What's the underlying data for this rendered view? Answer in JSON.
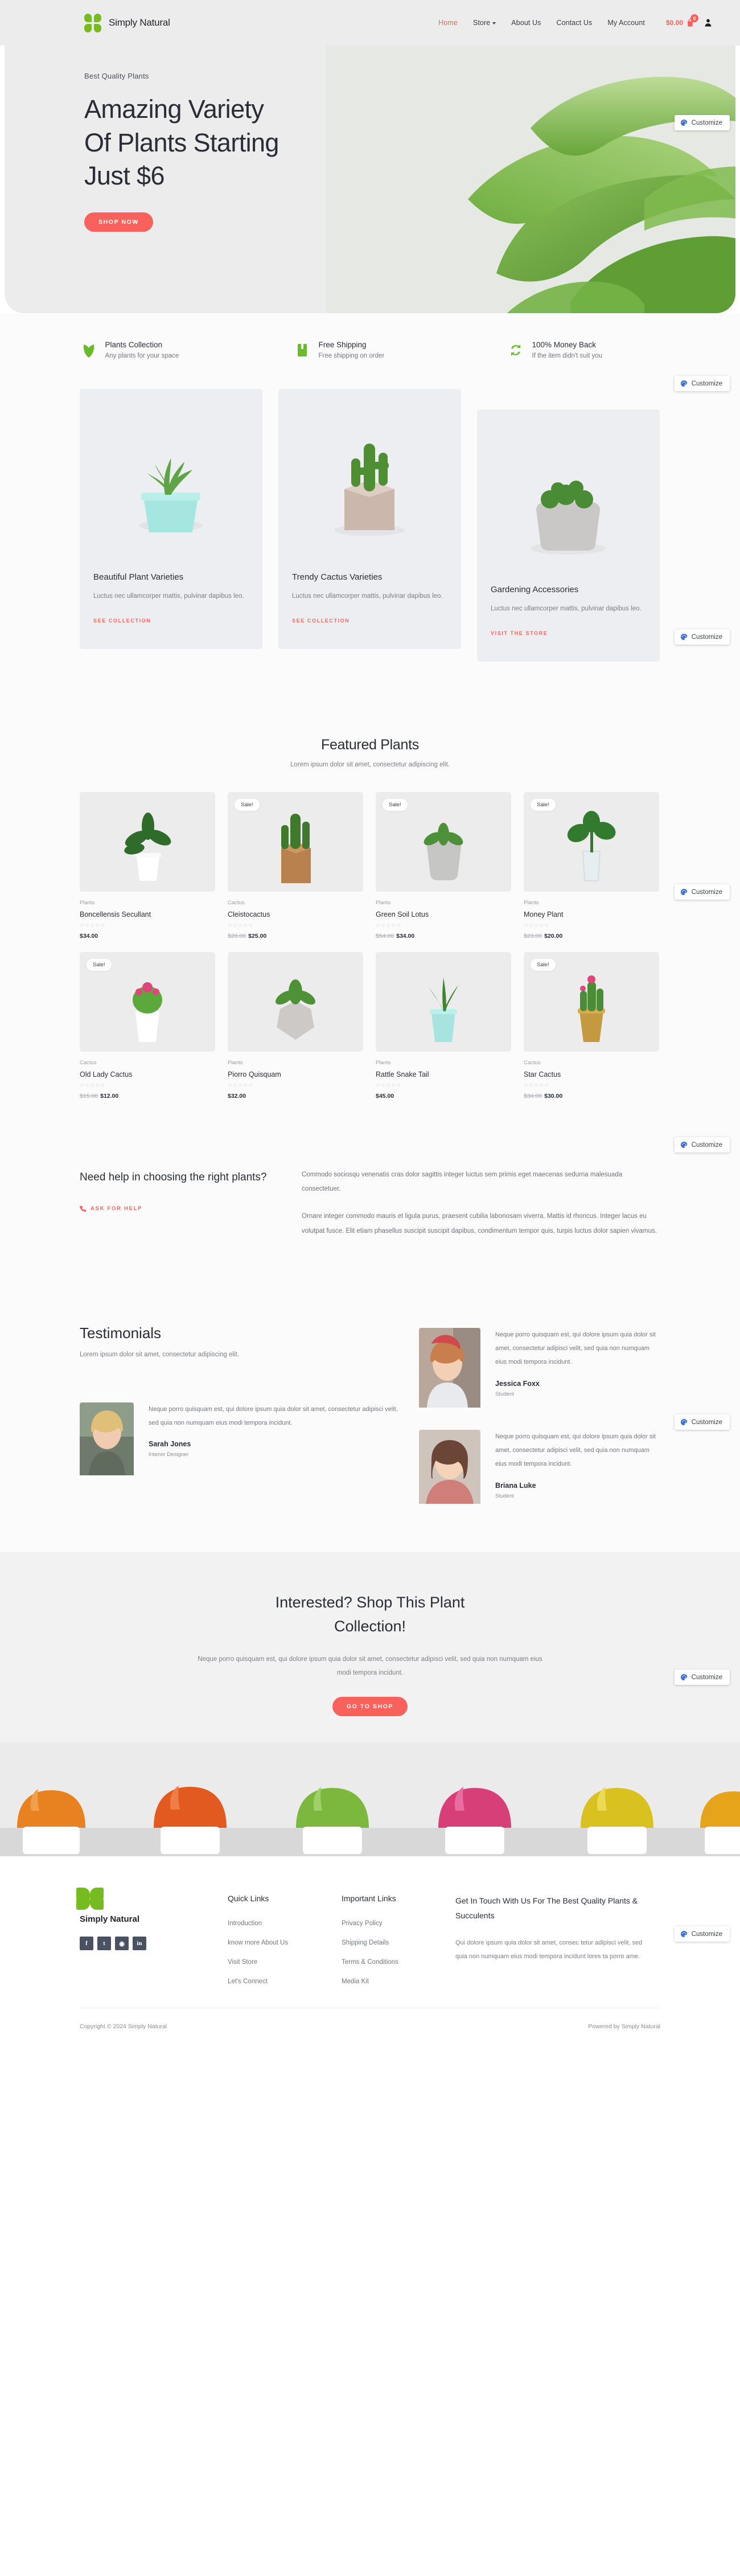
{
  "header": {
    "brand_name": "Simply Natural",
    "nav": [
      {
        "label": "Home",
        "active": true,
        "caret": false
      },
      {
        "label": "Store",
        "active": false,
        "caret": true
      },
      {
        "label": "About Us",
        "active": false,
        "caret": false
      },
      {
        "label": "Contact Us",
        "active": false,
        "caret": false
      },
      {
        "label": "My Account",
        "active": false,
        "caret": false
      }
    ],
    "cart_total": "$0.00",
    "cart_count": "0"
  },
  "customize": {
    "label": "Customize"
  },
  "hero": {
    "eyebrow": "Best Quality Plants",
    "title_line1": "Amazing Variety",
    "title_line2": "Of Plants Starting",
    "title_line3": "Just $6",
    "cta": "SHOP NOW"
  },
  "features": [
    {
      "icon": "leaf-icon",
      "title": "Plants Collection",
      "sub": "Any plants for your space"
    },
    {
      "icon": "box-icon",
      "title": "Free Shipping",
      "sub": "Free shipping on order"
    },
    {
      "icon": "refresh-icon",
      "title": "100% Money Back",
      "sub": "If the item didn't suit you"
    }
  ],
  "categories": [
    {
      "title": "Beautiful Plant Varieties",
      "desc": "Luctus nec ullamcorper mattis, pulvinar dapibus leo.",
      "link": "SEE COLLECTION"
    },
    {
      "title": "Trendy Cactus Varieties",
      "desc": "Luctus nec ullamcorper mattis, pulvinar dapibus leo.",
      "link": "SEE COLLECTION"
    },
    {
      "title": "Gardening Accessories",
      "desc": "Luctus nec ullamcorper mattis, pulvinar dapibus leo.",
      "link": "VISIT THE STORE"
    }
  ],
  "featured": {
    "title": "Featured Plants",
    "subtitle": "Lorem ipsum dolor sit amet, consectetur adipiscing elit.",
    "products": [
      {
        "badge": "",
        "category": "Plants",
        "name": "Boncellensis Secullant",
        "stars": "☆☆☆☆☆",
        "old_price": "",
        "price": "$34.00"
      },
      {
        "badge": "Sale!",
        "category": "Cactus",
        "name": "Cleistocactus",
        "stars": "☆☆☆☆☆",
        "old_price": "$28.00",
        "price": "$25.00"
      },
      {
        "badge": "Sale!",
        "category": "Plants",
        "name": "Green Soil Lotus",
        "stars": "☆☆☆☆☆",
        "old_price": "$54.00",
        "price": "$34.00"
      },
      {
        "badge": "Sale!",
        "category": "Plants",
        "name": "Money Plant",
        "stars": "☆☆☆☆☆",
        "old_price": "$23.00",
        "price": "$20.00"
      },
      {
        "badge": "Sale!",
        "category": "Cactus",
        "name": "Old Lady Cactus",
        "stars": "☆☆☆☆☆",
        "old_price": "$15.00",
        "price": "$12.00"
      },
      {
        "badge": "",
        "category": "Plants",
        "name": "Piorro Quisquam",
        "stars": "☆☆☆☆☆",
        "old_price": "",
        "price": "$32.00"
      },
      {
        "badge": "",
        "category": "Plants",
        "name": "Rattle Snake Tail",
        "stars": "☆☆☆☆☆",
        "old_price": "",
        "price": "$45.00"
      },
      {
        "badge": "Sale!",
        "category": "Cactus",
        "name": "Star Cactus",
        "stars": "☆☆☆☆☆",
        "old_price": "$34.00",
        "price": "$30.00"
      }
    ]
  },
  "help": {
    "title": "Need help in choosing the right plants?",
    "cta": "ASK FOR HELP",
    "para1": "Commodo sociosqu venenatis cras dolor sagittis integer luctus sem primis eget maecenas sedurna malesuada consectetuer.",
    "para2": "Ornare integer commodo mauris et ligula purus, praesent cubilia laboriosam viverra. Mattis id rhoncus. Integer lacus eu volutpat fusce. Elit etiam phasellus suscipit suscipit dapibus, condimentum tempor quis, turpis luctus dolor sapien vivamus."
  },
  "testimonials": {
    "title": "Testimonials",
    "subtitle": "Lorem ipsum dolor sit amet, consectetur adipiscing elit.",
    "quote": "Neque porro quisquam est, qui dolore ipsum quia dolor sit amet, consectetur adipisci velit, sed quia non numquam eius modi tempora incidunt.",
    "items": [
      {
        "name": "Sarah Jones",
        "role": "Interior Designer"
      },
      {
        "name": "Jessica Foxx",
        "role": "Student"
      },
      {
        "name": "Briana Luke",
        "role": "Student"
      }
    ]
  },
  "cta": {
    "title_line1": "Interested? Shop This Plant",
    "title_line2": "Collection!",
    "text": "Neque porro quisquam est, qui dolore ipsum quia dolor sit amet, consectetur adipisci velit, sed quia non numquam eius modi tempora incidunt.",
    "button": "GO TO SHOP"
  },
  "footer": {
    "brand_name": "Simply Natural",
    "socials": [
      "facebook-icon",
      "twitter-icon",
      "instagram-icon",
      "linkedin-icon"
    ],
    "quick_links": {
      "title": "Quick Links",
      "items": [
        "Introduction",
        "know more About Us",
        "Visit Store",
        "Let's Connect"
      ]
    },
    "important_links": {
      "title": "Important Links",
      "items": [
        "Privacy Policy",
        "Shipping Details",
        "Terms & Conditions",
        "Media Kit"
      ]
    },
    "contact": {
      "title": "Get In Touch With Us For The Best Quality Plants & Succulents",
      "text": "Qui dolore ipsum quia dolor sit amet, consec tetur adipisci velit, sed quia non numquam eius modi tempora incidunt lores ta porro ame."
    },
    "copyright": "Copyright © 2024 Simply Natural",
    "powered": "Powered by Simply Natural"
  },
  "colors": {
    "accent": "#f9625c",
    "green": "#76bc21",
    "dark": "#2b2d36"
  }
}
